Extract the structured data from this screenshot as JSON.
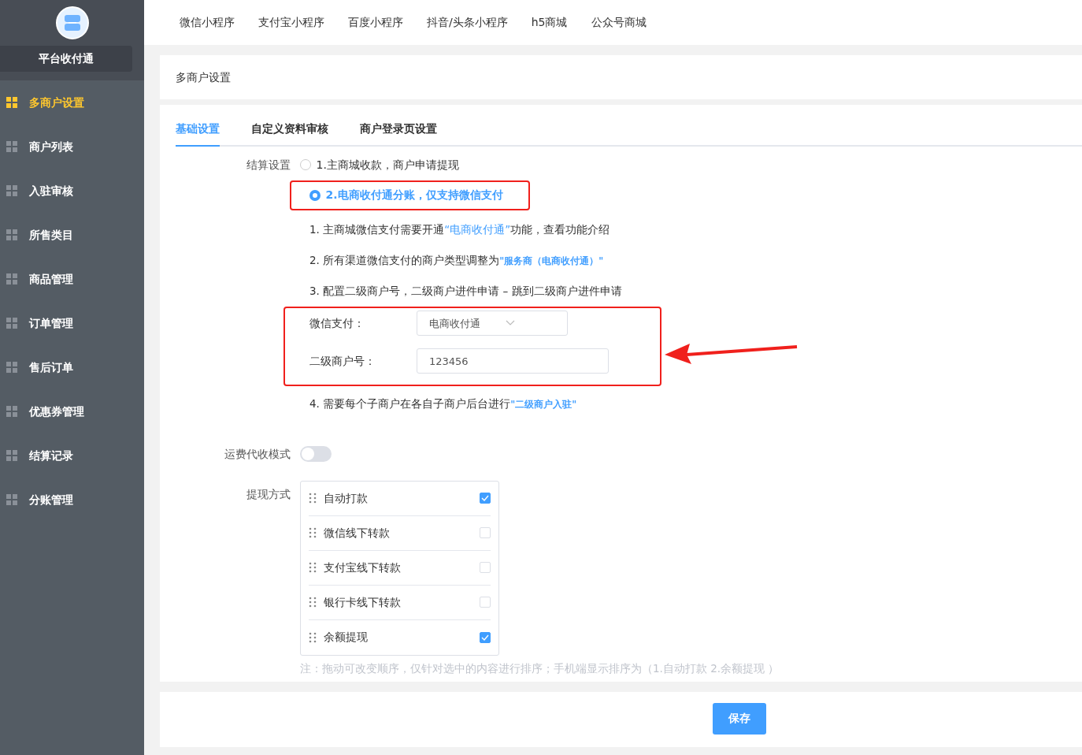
{
  "sidebar": {
    "title": "平台收付通",
    "items": [
      {
        "label": "多商户设置",
        "selected": true
      },
      {
        "label": "商户列表",
        "selected": false
      },
      {
        "label": "入驻审核",
        "selected": false
      },
      {
        "label": "所售类目",
        "selected": false
      },
      {
        "label": "商品管理",
        "selected": false
      },
      {
        "label": "订单管理",
        "selected": false
      },
      {
        "label": "售后订单",
        "selected": false
      },
      {
        "label": "优惠券管理",
        "selected": false
      },
      {
        "label": "结算记录",
        "selected": false
      },
      {
        "label": "分账管理",
        "selected": false
      }
    ]
  },
  "top_tabs": [
    "微信小程序",
    "支付宝小程序",
    "百度小程序",
    "抖音/头条小程序",
    "h5商城",
    "公众号商城"
  ],
  "page_title": "多商户设置",
  "tabs": [
    {
      "label": "基础设置",
      "selected": true
    },
    {
      "label": "自定义资料审核",
      "selected": false
    },
    {
      "label": "商户登录页设置",
      "selected": false
    }
  ],
  "settlement": {
    "label": "结算设置",
    "options": [
      {
        "label": "1.主商城收款，商户申请提现",
        "selected": false
      },
      {
        "label": "2.电商收付通分账，仅支持微信支付",
        "selected": true
      }
    ],
    "notes": [
      {
        "text": "1. 主商城微信支付需要开通",
        "link": "“电商收付通”",
        "after": "功能，查看功能介绍"
      },
      {
        "text": "2. 所有渠道微信支付的商户类型调整为",
        "link": "\"服务商（电商收付通）\""
      },
      {
        "text": "3. 配置二级商户号，二级商户进件申请 – 跳到二级商户进件申请"
      }
    ],
    "wechat_pay": {
      "label": "微信支付：",
      "value": "电商收付通"
    },
    "sub_merchant": {
      "label": "二级商户号：",
      "value": "123456"
    },
    "note_4": {
      "text": "4. 需要每个子商户在各自子商户后台进行",
      "link": "\"二级商户入驻\""
    }
  },
  "freight": {
    "label": "运费代收模式",
    "on": false
  },
  "withdraw": {
    "label": "提现方式",
    "items": [
      {
        "label": "自动打款",
        "checked": true
      },
      {
        "label": "微信线下转款",
        "checked": false
      },
      {
        "label": "支付宝线下转款",
        "checked": false
      },
      {
        "label": "银行卡线下转款",
        "checked": false
      },
      {
        "label": "余额提现",
        "checked": true
      }
    ],
    "hint": "注：拖动可改变顺序，仅针对选中的内容进行排序；手机端显示排序为（1.自动打款 2.余额提现 ）"
  },
  "save_button": "保存"
}
